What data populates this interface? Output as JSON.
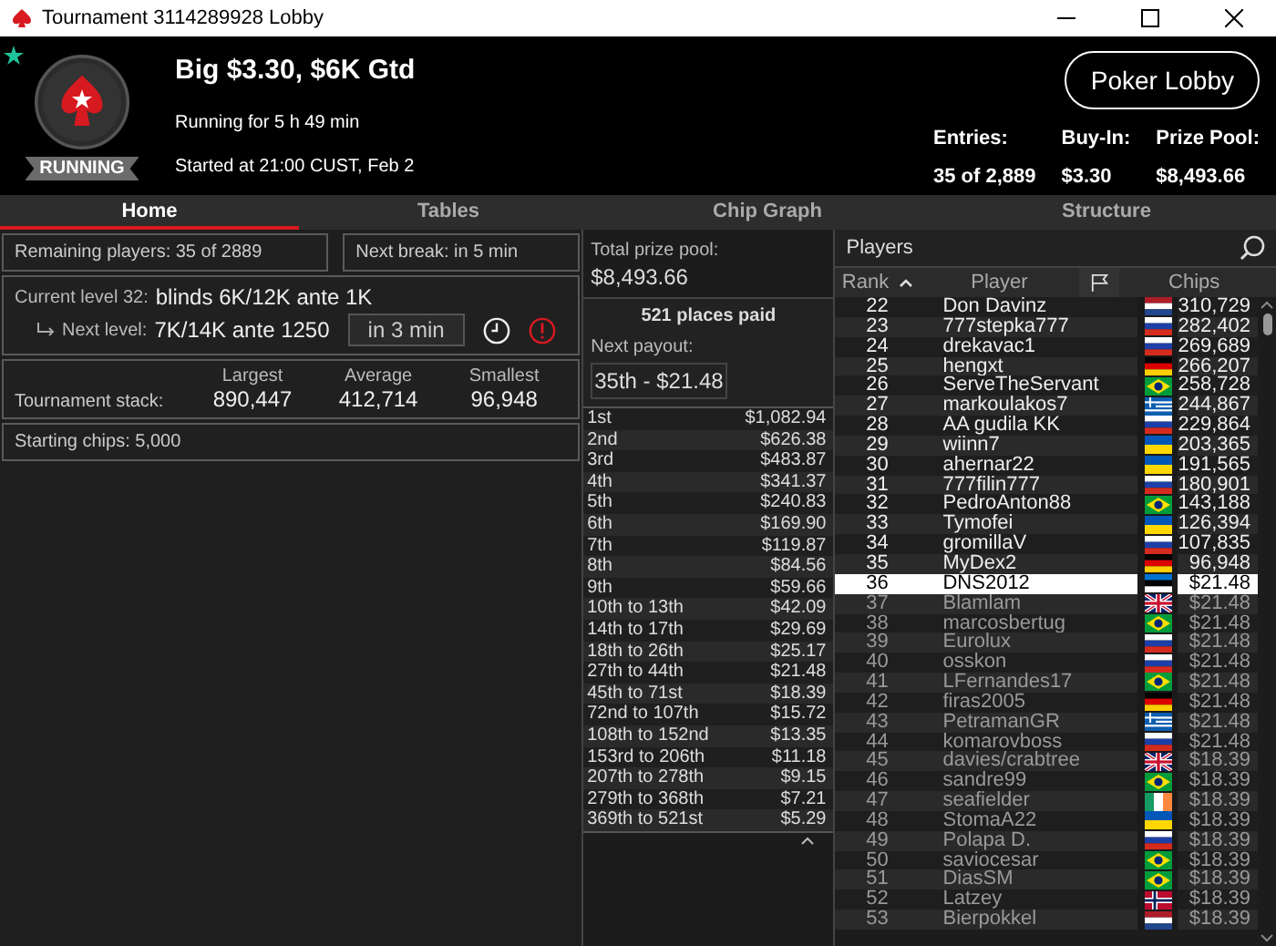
{
  "window": {
    "title": "Tournament 3114289928 Lobby"
  },
  "header": {
    "favorite": true,
    "status": "RUNNING",
    "name": "Big $3.30, $6K Gtd",
    "running_for": "Running for 5 h 49 min",
    "started": "Started at 21:00 CUST, Feb 2",
    "lobby_button": "Poker Lobby",
    "stats": [
      {
        "label": "Entries:",
        "value": "35 of 2,889"
      },
      {
        "label": "Buy-In:",
        "value": "$3.30"
      },
      {
        "label": "Prize Pool:",
        "value": "$8,493.66"
      }
    ]
  },
  "tabs": [
    {
      "label": "Home",
      "selected": true
    },
    {
      "label": "Tables",
      "selected": false
    },
    {
      "label": "Chip Graph",
      "selected": false
    },
    {
      "label": "Structure",
      "selected": false
    }
  ],
  "home": {
    "remaining": "Remaining players: 35 of 2889",
    "next_break": "Next break: in 5 min",
    "current_level_label": "Current level 32:",
    "current_level": "blinds 6K/12K ante 1K",
    "next_level_label": "Next level:",
    "next_level": "7K/14K ante 1250",
    "next_level_time": "in 3 min",
    "stack_label": "Tournament stack:",
    "stacks": [
      {
        "label": "Largest",
        "value": "890,447"
      },
      {
        "label": "Average",
        "value": "412,714"
      },
      {
        "label": "Smallest",
        "value": "96,948"
      }
    ],
    "starting_chips": "Starting chips:  5,000"
  },
  "prizes": {
    "total_label": "Total prize pool:",
    "total": "$8,493.66",
    "places_paid": "521 places paid",
    "next_payout_label": "Next payout:",
    "next_payout": "35th - $21.48",
    "rows": [
      {
        "place": "1st",
        "amount": "$1,082.94"
      },
      {
        "place": "2nd",
        "amount": "$626.38"
      },
      {
        "place": "3rd",
        "amount": "$483.87"
      },
      {
        "place": "4th",
        "amount": "$341.37"
      },
      {
        "place": "5th",
        "amount": "$240.83"
      },
      {
        "place": "6th",
        "amount": "$169.90"
      },
      {
        "place": "7th",
        "amount": "$119.87"
      },
      {
        "place": "8th",
        "amount": "$84.56"
      },
      {
        "place": "9th",
        "amount": "$59.66"
      },
      {
        "place": "10th to 13th",
        "amount": "$42.09"
      },
      {
        "place": "14th to 17th",
        "amount": "$29.69"
      },
      {
        "place": "18th to 26th",
        "amount": "$25.17"
      },
      {
        "place": "27th to 44th",
        "amount": "$21.48"
      },
      {
        "place": "45th to 71st",
        "amount": "$18.39"
      },
      {
        "place": "72nd to 107th",
        "amount": "$15.72"
      },
      {
        "place": "108th to 152nd",
        "amount": "$13.35"
      },
      {
        "place": "153rd to 206th",
        "amount": "$11.18"
      },
      {
        "place": "207th to 278th",
        "amount": "$9.15"
      },
      {
        "place": "279th to 368th",
        "amount": "$7.21"
      },
      {
        "place": "369th to 521st",
        "amount": "$5.29"
      }
    ]
  },
  "players": {
    "title": "Players",
    "columns": [
      "Rank",
      "Player",
      "Chips"
    ],
    "rows": [
      {
        "rank": "22",
        "name": "Don Davinz",
        "kind": "nl",
        "chips": "310,729",
        "eliminated": false,
        "selected": false
      },
      {
        "rank": "23",
        "name": "777stepka777",
        "kind": "ru",
        "chips": "282,402",
        "eliminated": false,
        "selected": false
      },
      {
        "rank": "24",
        "name": "drekavac1",
        "kind": "si",
        "chips": "269,689",
        "eliminated": false,
        "selected": false
      },
      {
        "rank": "25",
        "name": "hengxt",
        "kind": "de",
        "chips": "266,207",
        "eliminated": false,
        "selected": false
      },
      {
        "rank": "26",
        "name": "ServeTheServant",
        "kind": "br",
        "chips": "258,728",
        "eliminated": false,
        "selected": false
      },
      {
        "rank": "27",
        "name": "markoulakos7",
        "kind": "gr",
        "chips": "244,867",
        "eliminated": false,
        "selected": false
      },
      {
        "rank": "28",
        "name": "AA gudila KK",
        "kind": "ru",
        "chips": "229,864",
        "eliminated": false,
        "selected": false
      },
      {
        "rank": "29",
        "name": "wiinn7",
        "kind": "ua",
        "chips": "203,365",
        "eliminated": false,
        "selected": false
      },
      {
        "rank": "30",
        "name": "ahernar22",
        "kind": "ua",
        "chips": "191,565",
        "eliminated": false,
        "selected": false
      },
      {
        "rank": "31",
        "name": "777filin777",
        "kind": "ru",
        "chips": "180,901",
        "eliminated": false,
        "selected": false
      },
      {
        "rank": "32",
        "name": "PedroAnton88",
        "kind": "br",
        "chips": "143,188",
        "eliminated": false,
        "selected": false
      },
      {
        "rank": "33",
        "name": "Tymofei",
        "kind": "ua",
        "chips": "126,394",
        "eliminated": false,
        "selected": false
      },
      {
        "rank": "34",
        "name": "gromillaV",
        "kind": "ru",
        "chips": "107,835",
        "eliminated": false,
        "selected": false
      },
      {
        "rank": "35",
        "name": "MyDex2",
        "kind": "de",
        "chips": "96,948",
        "eliminated": false,
        "selected": false
      },
      {
        "rank": "36",
        "name": "DNS2012",
        "kind": "ee",
        "chips": "$21.48",
        "eliminated": true,
        "selected": true
      },
      {
        "rank": "37",
        "name": "Blamlam",
        "kind": "gb",
        "chips": "$21.48",
        "eliminated": true,
        "selected": false
      },
      {
        "rank": "38",
        "name": "marcosbertug",
        "kind": "br",
        "chips": "$21.48",
        "eliminated": true,
        "selected": false
      },
      {
        "rank": "39",
        "name": "Eurolux",
        "kind": "ru",
        "chips": "$21.48",
        "eliminated": true,
        "selected": false
      },
      {
        "rank": "40",
        "name": "osskon",
        "kind": "ru",
        "chips": "$21.48",
        "eliminated": true,
        "selected": false
      },
      {
        "rank": "41",
        "name": "LFernandes17",
        "kind": "br",
        "chips": "$21.48",
        "eliminated": true,
        "selected": false
      },
      {
        "rank": "42",
        "name": "firas2005",
        "kind": "de",
        "chips": "$21.48",
        "eliminated": true,
        "selected": false
      },
      {
        "rank": "43",
        "name": "PetramanGR",
        "kind": "gr",
        "chips": "$21.48",
        "eliminated": true,
        "selected": false
      },
      {
        "rank": "44",
        "name": "komarovboss",
        "kind": "ru",
        "chips": "$21.48",
        "eliminated": true,
        "selected": false
      },
      {
        "rank": "45",
        "name": "davies/crabtree",
        "kind": "gb",
        "chips": "$18.39",
        "eliminated": true,
        "selected": false
      },
      {
        "rank": "46",
        "name": "sandre99",
        "kind": "br",
        "chips": "$18.39",
        "eliminated": true,
        "selected": false
      },
      {
        "rank": "47",
        "name": "seafielder",
        "kind": "ie",
        "chips": "$18.39",
        "eliminated": true,
        "selected": false
      },
      {
        "rank": "48",
        "name": "StomaA22",
        "kind": "ua",
        "chips": "$18.39",
        "eliminated": true,
        "selected": false
      },
      {
        "rank": "49",
        "name": "Polapa D.",
        "kind": "ru",
        "chips": "$18.39",
        "eliminated": true,
        "selected": false
      },
      {
        "rank": "50",
        "name": "saviocesar",
        "kind": "br",
        "chips": "$18.39",
        "eliminated": true,
        "selected": false
      },
      {
        "rank": "51",
        "name": "DiasSM",
        "kind": "br",
        "chips": "$18.39",
        "eliminated": true,
        "selected": false
      },
      {
        "rank": "52",
        "name": "Latzey",
        "kind": "no",
        "chips": "$18.39",
        "eliminated": true,
        "selected": false
      },
      {
        "rank": "53",
        "name": "Bierpokkel",
        "kind": "nl",
        "chips": "$18.39",
        "eliminated": true,
        "selected": false
      }
    ]
  }
}
